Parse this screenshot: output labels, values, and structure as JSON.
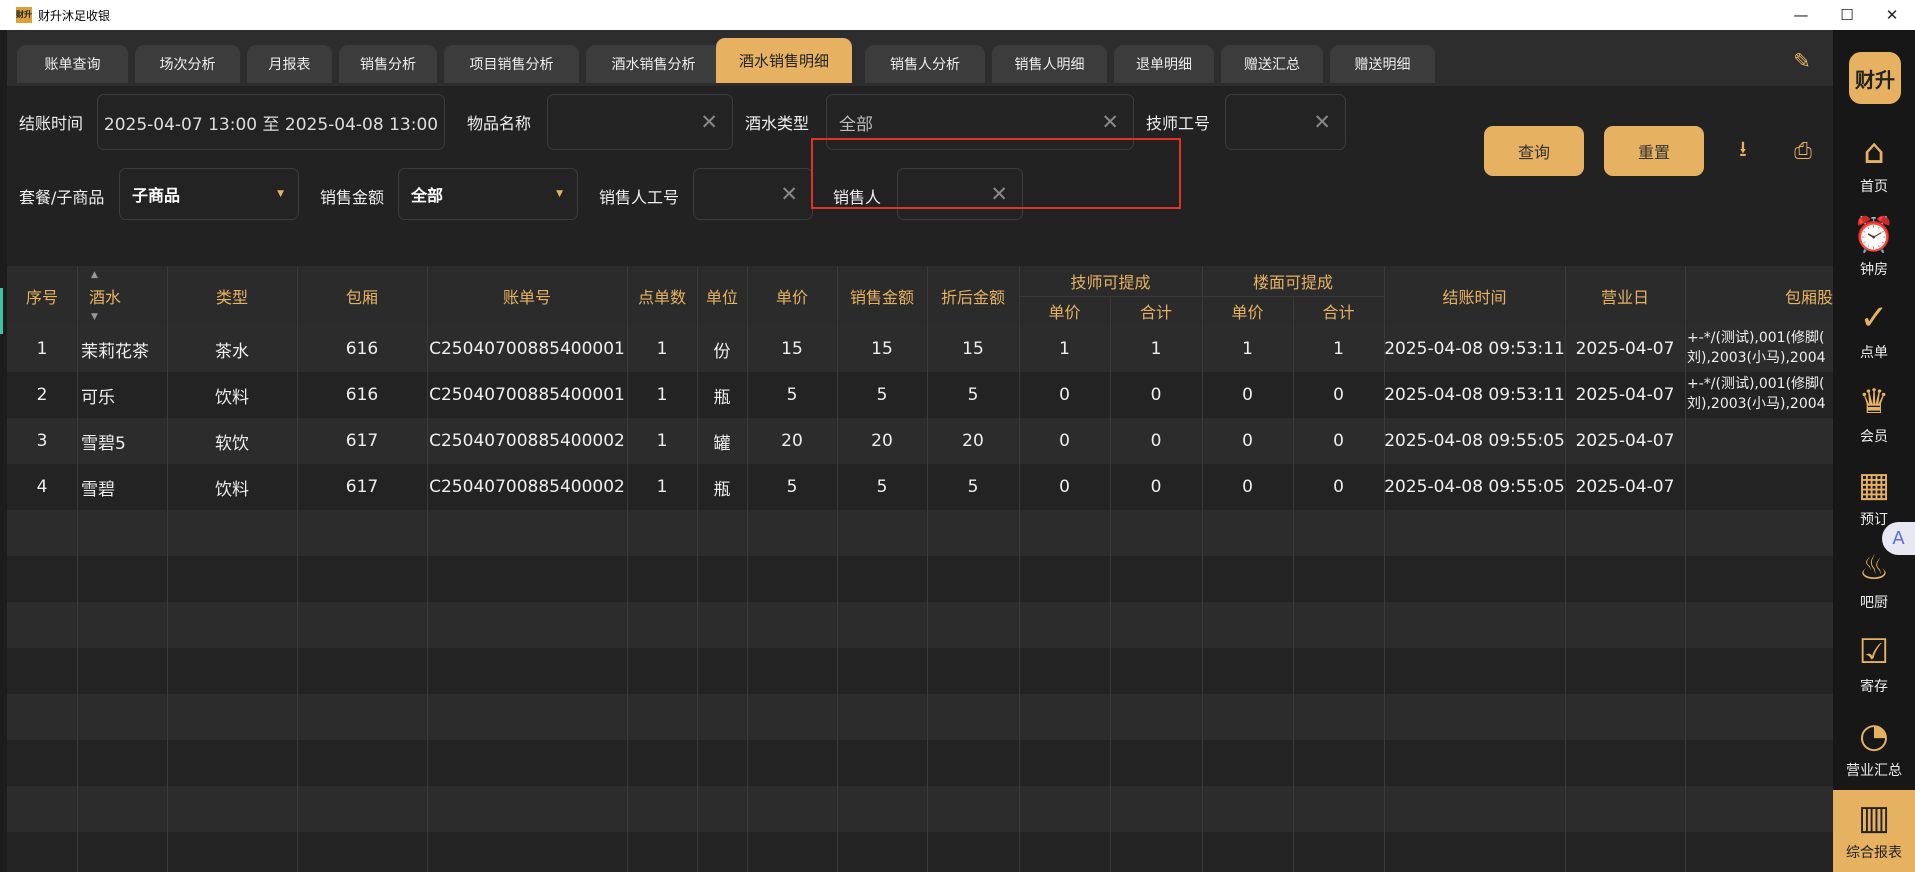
{
  "window": {
    "title": "财升沐足收银",
    "app_icon_text": "财升",
    "minimize_glyph": "—",
    "maximize_glyph": "☐",
    "close_glyph": "✕"
  },
  "tabs": [
    {
      "label": "账单查询"
    },
    {
      "label": "场次分析"
    },
    {
      "label": "月报表"
    },
    {
      "label": "销售分析"
    },
    {
      "label": "项目销售分析"
    },
    {
      "label": "酒水销售分析"
    },
    {
      "label": "酒水销售明细",
      "active": true
    },
    {
      "label": "销售人分析"
    },
    {
      "label": "销售人明细"
    },
    {
      "label": "退单明细"
    },
    {
      "label": "赠送汇总"
    },
    {
      "label": "赠送明细"
    }
  ],
  "filters": {
    "checkout_time_label": "结账时间",
    "checkout_time_value": "2025-04-07 13:00 至 2025-04-08 13:00",
    "item_name_label": "物品名称",
    "item_name_value": "",
    "drink_type_label": "酒水类型",
    "drink_type_value": "全部",
    "tech_id_label": "技师工号",
    "tech_id_value": "",
    "package_label": "套餐/子商品",
    "package_value": "子商品",
    "sales_amount_label": "销售金额",
    "sales_amount_value": "全部",
    "seller_id_label": "销售人工号",
    "seller_id_value": "",
    "seller_label": "销售人",
    "seller_value": "",
    "clear_glyph": "✕",
    "caret_glyph": "▼"
  },
  "buttons": {
    "query": "查询",
    "reset": "重置",
    "download_glyph": "⭳",
    "print_glyph": "⎙"
  },
  "table": {
    "headers": {
      "seq": "序号",
      "drink": "酒水",
      "type": "类型",
      "room": "包厢",
      "bill_no": "账单号",
      "qty": "点单数",
      "unit": "单位",
      "unit_price": "单价",
      "sales_amount": "销售金额",
      "discount_amount": "折后金额",
      "tech_commission": "技师可提成",
      "floor_commission": "楼面可提成",
      "tech_unit_price": "单价",
      "tech_total": "合计",
      "floor_unit_price": "单价",
      "floor_total": "合计",
      "checkout_time": "结账时间",
      "business_day": "营业日",
      "room_tech": "包厢股"
    },
    "rows": [
      {
        "seq": "1",
        "drink": "茉莉花茶",
        "type": "茶水",
        "room": "616",
        "bill_no": "C25040700885400001",
        "qty": "1",
        "unit": "份",
        "unit_price": "15",
        "sales_amount": "15",
        "discount_amount": "15",
        "tech_unit": "1",
        "tech_total": "1",
        "floor_unit": "1",
        "floor_total": "1",
        "checkout_time": "2025-04-08 09:53:11",
        "business_day": "2025-04-07",
        "room_tech_line1": "+-*/(测试),001(修脚(",
        "room_tech_line2": "刘),2003(小马),2004"
      },
      {
        "seq": "2",
        "drink": "可乐",
        "type": "饮料",
        "room": "616",
        "bill_no": "C25040700885400001",
        "qty": "1",
        "unit": "瓶",
        "unit_price": "5",
        "sales_amount": "5",
        "discount_amount": "5",
        "tech_unit": "0",
        "tech_total": "0",
        "floor_unit": "0",
        "floor_total": "0",
        "checkout_time": "2025-04-08 09:53:11",
        "business_day": "2025-04-07",
        "room_tech_line1": "+-*/(测试),001(修脚(",
        "room_tech_line2": "刘),2003(小马),2004"
      },
      {
        "seq": "3",
        "drink": "雪碧5",
        "type": "软饮",
        "room": "617",
        "bill_no": "C25040700885400002",
        "qty": "1",
        "unit": "罐",
        "unit_price": "20",
        "sales_amount": "20",
        "discount_amount": "20",
        "tech_unit": "0",
        "tech_total": "0",
        "floor_unit": "0",
        "floor_total": "0",
        "checkout_time": "2025-04-08 09:55:05",
        "business_day": "2025-04-07",
        "room_tech_line1": "",
        "room_tech_line2": ""
      },
      {
        "seq": "4",
        "drink": "雪碧",
        "type": "饮料",
        "room": "617",
        "bill_no": "C25040700885400002",
        "qty": "1",
        "unit": "瓶",
        "unit_price": "5",
        "sales_amount": "5",
        "discount_amount": "5",
        "tech_unit": "0",
        "tech_total": "0",
        "floor_unit": "0",
        "floor_total": "0",
        "checkout_time": "2025-04-08 09:55:05",
        "business_day": "2025-04-07",
        "room_tech_line1": "",
        "room_tech_line2": ""
      }
    ]
  },
  "sidebar": {
    "logo": "财升",
    "items": [
      {
        "label": "首页",
        "icon": "home-icon",
        "glyph": "⌂"
      },
      {
        "label": "钟房",
        "icon": "alarm-clock-icon",
        "glyph": "⏰"
      },
      {
        "label": "点单",
        "icon": "clipboard-check-icon",
        "glyph": "✓"
      },
      {
        "label": "会员",
        "icon": "crown-icon",
        "glyph": "♛"
      },
      {
        "label": "预订",
        "icon": "calendar-clock-icon",
        "glyph": "▦"
      },
      {
        "label": "吧厨",
        "icon": "cooking-pot-icon",
        "glyph": "♨"
      },
      {
        "label": "寄存",
        "icon": "storage-box-icon",
        "glyph": "☑"
      },
      {
        "label": "营业汇总",
        "icon": "pie-chart-icon",
        "glyph": "◔"
      },
      {
        "label": "综合报表",
        "icon": "bar-chart-icon",
        "glyph": "▥",
        "active": true
      }
    ]
  },
  "assistant_glyph": "A"
}
